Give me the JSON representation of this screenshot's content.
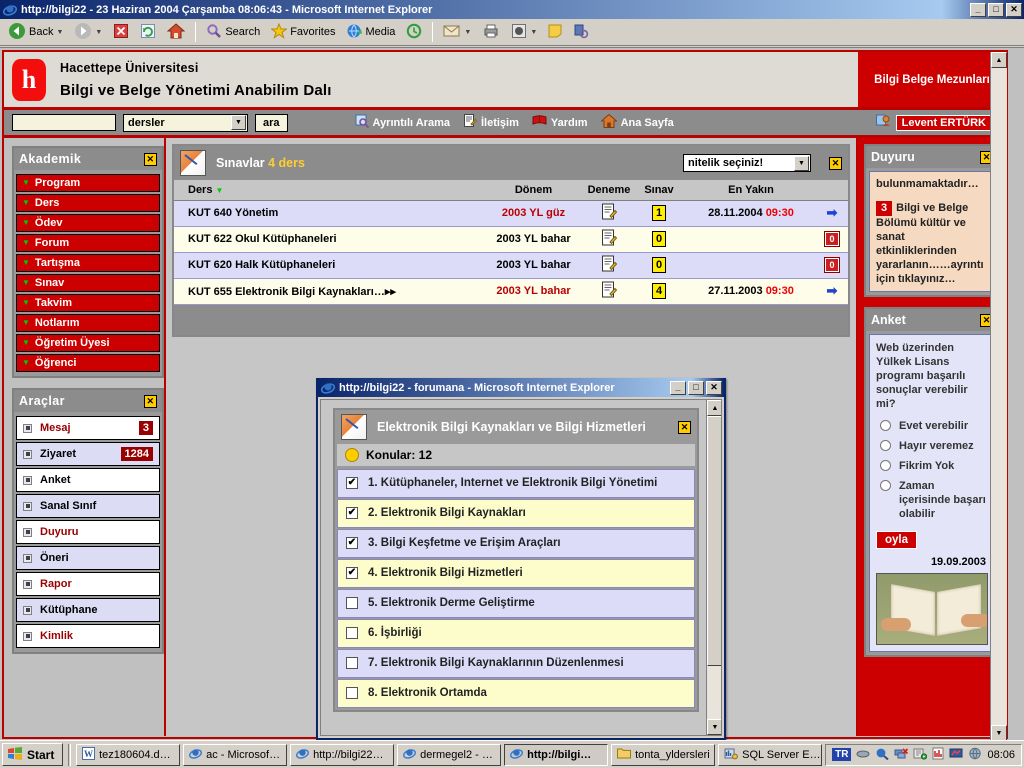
{
  "browser": {
    "title": "http://bilgi22 - 23 Haziran 2004 Çarşamba 08:06:43 - Microsoft Internet Explorer",
    "title_icon": "ie-icon",
    "minimize": "_",
    "maximize": "□",
    "close": "✕",
    "toolbar": {
      "back": "Back",
      "search": "Search",
      "favorites": "Favorites",
      "media": "Media",
      "icons": [
        "back-icon",
        "forward-icon",
        "stop-icon",
        "refresh-icon",
        "home-icon",
        "search-icon",
        "favorites-icon",
        "media-icon",
        "history-icon",
        "mail-icon",
        "print-icon",
        "discuss-icon",
        "edit-icon",
        "messenger-icon"
      ]
    }
  },
  "banner": {
    "logo_glyph": "h",
    "university": "Hacettepe Üniversitesi",
    "department": "Bilgi ve Belge Yönetimi Anabilim Dalı",
    "right_label": "Bilgi Belge Mezunları"
  },
  "searchbar": {
    "input_value": "",
    "input_placeholder": "",
    "select_value": "dersler",
    "button": "ara",
    "links": [
      {
        "label": "Ayrıntılı Arama",
        "icon": "detailed-search-icon"
      },
      {
        "label": "İletişim",
        "icon": "contact-icon"
      },
      {
        "label": "Yardım",
        "icon": "help-book-icon"
      },
      {
        "label": "Ana Sayfa",
        "icon": "home-icon"
      }
    ],
    "user": "Levent ERTÜRK",
    "user_icon": "user-icon"
  },
  "sidebar_left": {
    "akademik": {
      "title": "Akademik",
      "close": "✕",
      "items": [
        {
          "label": "Program"
        },
        {
          "label": "Ders"
        },
        {
          "label": "Ödev"
        },
        {
          "label": "Forum"
        },
        {
          "label": "Tartışma"
        },
        {
          "label": "Sınav"
        },
        {
          "label": "Takvim"
        },
        {
          "label": "Notlarım"
        },
        {
          "label": "Öğretim Üyesi"
        },
        {
          "label": "Öğrenci"
        }
      ]
    },
    "araclar": {
      "title": "Araçlar",
      "close": "✕",
      "items": [
        {
          "label": "Mesaj",
          "badge": "3",
          "color": "#990000"
        },
        {
          "label": "Ziyaret",
          "badge": "1284",
          "color": "#000000"
        },
        {
          "label": "Anket",
          "badge": "",
          "color": "#000000"
        },
        {
          "label": "Sanal Sınıf",
          "badge": "",
          "color": "#000000"
        },
        {
          "label": "Duyuru",
          "badge": "",
          "color": "#990000"
        },
        {
          "label": "Öneri",
          "badge": "",
          "color": "#000000"
        },
        {
          "label": "Rapor",
          "badge": "",
          "color": "#990000"
        },
        {
          "label": "Kütüphane",
          "badge": "",
          "color": "#000000"
        },
        {
          "label": "Kimlik",
          "badge": "",
          "color": "#990000"
        }
      ]
    }
  },
  "main": {
    "card_icon": "pencil-writing-icon",
    "title": "Sınavlar",
    "count_text": "4 ders",
    "filter_value": "nitelik seçiniz!",
    "close": "✕",
    "columns": [
      "Ders",
      "Dönem",
      "Deneme",
      "Sınav",
      "En Yakın",
      ""
    ],
    "sort_column": "Ders",
    "rows": [
      {
        "ders": "KUT 640 Yönetim",
        "donem": "2003 YL güz",
        "donem_red": true,
        "deneme_icon": "exam-doc-icon",
        "sinav": "1",
        "en_yakin_date": "28.11.2004",
        "en_yakin_time": "09:30",
        "action": "arrow"
      },
      {
        "ders": "KUT 622 Okul Kütüphaneleri",
        "donem": "2003 YL bahar",
        "donem_red": false,
        "deneme_icon": "exam-doc-icon",
        "sinav": "0",
        "en_yakin_date": "",
        "en_yakin_time": "",
        "action": "stop"
      },
      {
        "ders": "KUT 620 Halk Kütüphaneleri",
        "donem": "2003 YL bahar",
        "donem_red": false,
        "deneme_icon": "exam-doc-icon",
        "sinav": "0",
        "en_yakin_date": "",
        "en_yakin_time": "",
        "action": "stop"
      },
      {
        "ders": "KUT 655 Elektronik Bilgi Kaynakları…▸▸",
        "donem": "2003 YL bahar",
        "donem_red": true,
        "deneme_icon": "exam-doc-icon",
        "sinav": "4",
        "en_yakin_date": "27.11.2003",
        "en_yakin_time": "09:30",
        "action": "arrow"
      }
    ]
  },
  "sidebar_right": {
    "duyuru": {
      "title": "Duyuru",
      "close": "✕",
      "line1": "bulunmamaktadır…",
      "badge": "3",
      "body": "Bilgi ve Belge Bölümü kültür ve sanat etkinliklerinden yararlanın……ayrıntı için tıklayınız…"
    },
    "anket": {
      "title": "Anket",
      "close": "✕",
      "question": "Web üzerinden Yülkek Lisans programı başarılı sonuçlar verebilir mi?",
      "options": [
        "Evet verebilir",
        "Hayır veremez",
        "Fikrim Yok",
        "Zaman içerisinde başarı olabilir"
      ],
      "vote_button": "oyla",
      "date": "19.09.2003",
      "image_alt": "open-book-hands-image"
    }
  },
  "popup": {
    "title": "http://bilgi22 - forumana - Microsoft Internet Explorer",
    "title_icon": "ie-icon",
    "minimize": "_",
    "maximize": "□",
    "close": "✕",
    "card_icon": "pencil-writing-icon",
    "card_title": "Elektronik Bilgi Kaynakları ve Bilgi Hizmetleri",
    "card_close": "✕",
    "subtitle": "Konular: 12",
    "subtitle_icon": "smiley-icon",
    "topics": [
      {
        "label": "1. Kütüphaneler, Internet ve Elektronik Bilgi Yönetimi",
        "checked": true
      },
      {
        "label": "2. Elektronik Bilgi Kaynakları",
        "checked": true
      },
      {
        "label": "3. Bilgi Keşfetme ve Erişim Araçları",
        "checked": true
      },
      {
        "label": "4. Elektronik Bilgi Hizmetleri",
        "checked": true
      },
      {
        "label": "5. Elektronik Derme Geliştirme",
        "checked": false
      },
      {
        "label": "6. İşbirliği",
        "checked": false
      },
      {
        "label": "7. Elektronik Bilgi Kaynaklarının Düzenlenmesi",
        "checked": false
      },
      {
        "label": "8. Elektronik Ortamda",
        "checked": false
      }
    ]
  },
  "taskbar": {
    "start": "Start",
    "items": [
      {
        "label": "tez180604.d…",
        "icon": "word-icon",
        "active": false
      },
      {
        "label": "ac - Microsof…",
        "icon": "ie-icon",
        "active": false
      },
      {
        "label": "http://bilgi22…",
        "icon": "ie-icon",
        "active": false
      },
      {
        "label": "dermegel2 - …",
        "icon": "ie-icon",
        "active": false
      },
      {
        "label": "http://bilgi…",
        "icon": "ie-icon",
        "active": true
      },
      {
        "label": "tonta_yldersleri",
        "icon": "folder-icon",
        "active": false
      },
      {
        "label": "SQL Server E…",
        "icon": "sql-icon",
        "active": false
      }
    ],
    "tray_lang": "TR",
    "tray_icons": [
      "volume-icon",
      "search-icon",
      "network-disconnected-icon",
      "media-icon",
      "chart-icon",
      "display-icon",
      "globe-icon"
    ],
    "clock": "08:06"
  },
  "colors": {
    "brand_red": "#cc0000",
    "accent_yellow": "#ffee00",
    "title_blue": "#0a246a",
    "row_odd": "#dcdcf8",
    "row_even": "#fdfdea"
  }
}
